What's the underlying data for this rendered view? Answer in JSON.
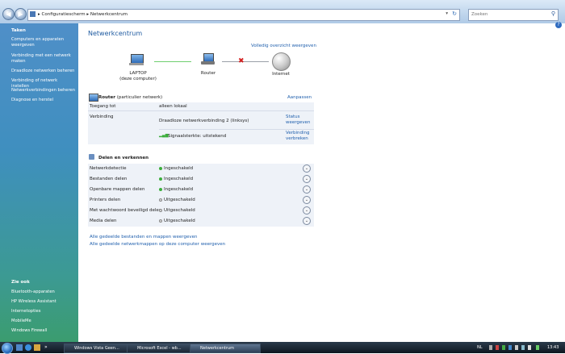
{
  "address": {
    "path": [
      "Configuratiescherm",
      "Netwerkcentrum"
    ],
    "search_placeholder": "Zoeken"
  },
  "sidebar": {
    "tasks_title": "Taken",
    "tasks": [
      "Computers en apparaten weergeven",
      "Verbinding met een netwerk maken",
      "Draadloze netwerken beheren",
      "Verbinding of netwerk instellen",
      "Netwerkverbindingen beheren",
      "Diagnose en herstel"
    ],
    "seealso_title": "Zie ook",
    "seealso": [
      "Bluetooth-apparaten",
      "HP Wireless Assistant",
      "Internetopties",
      "MobileMe",
      "Windows Firewall"
    ]
  },
  "main": {
    "title": "Netwerkcentrum",
    "full_map_link": "Volledig overzicht weergeven",
    "map": {
      "laptop": "LAPTOP",
      "laptop_sub": "(deze computer)",
      "router": "Router",
      "internet": "Internet"
    },
    "network": {
      "name": "Router",
      "type": "(particulier netwerk)",
      "customize": "Aanpassen",
      "access_label": "Toegang tot",
      "access_value": "alleen lokaal",
      "connection_label": "Verbinding",
      "connection_value": "Draadloze netwerkverbinding 2 (linksys)",
      "status_link": "Status weergeven",
      "signal_value": "Signaalsterkte: uitstekend",
      "disconnect_link": "Verbinding verbreken"
    },
    "sharing": {
      "title": "Delen en verkennen",
      "items": [
        {
          "label": "Netwerkdetectie",
          "status": "Ingeschakeld",
          "on": true
        },
        {
          "label": "Bestanden delen",
          "status": "Ingeschakeld",
          "on": true
        },
        {
          "label": "Openbare mappen delen",
          "status": "Ingeschakeld",
          "on": true
        },
        {
          "label": "Printers delen",
          "status": "Uitgeschakeld",
          "on": false
        },
        {
          "label": "Met wachtwoord beveiligd delen",
          "status": "Uitgeschakeld",
          "on": false
        },
        {
          "label": "Media delen",
          "status": "Uitgeschakeld",
          "on": false
        }
      ]
    },
    "bottom_links": [
      "Alle gedeelde bestanden en mappen weergeven",
      "Alle gedeelde netwerkmappen op deze computer weergeven"
    ]
  },
  "taskbar": {
    "tasks": [
      "Windows Vista Geen...",
      "Microsoft Excel - wb...",
      "Netwerkcentrum"
    ],
    "language": "NL",
    "clock": "13:43"
  },
  "colors": {
    "link": "#1f5fad",
    "on": "#3cae3c",
    "off": "#e0e0e0",
    "disconnected": "#d42020"
  }
}
